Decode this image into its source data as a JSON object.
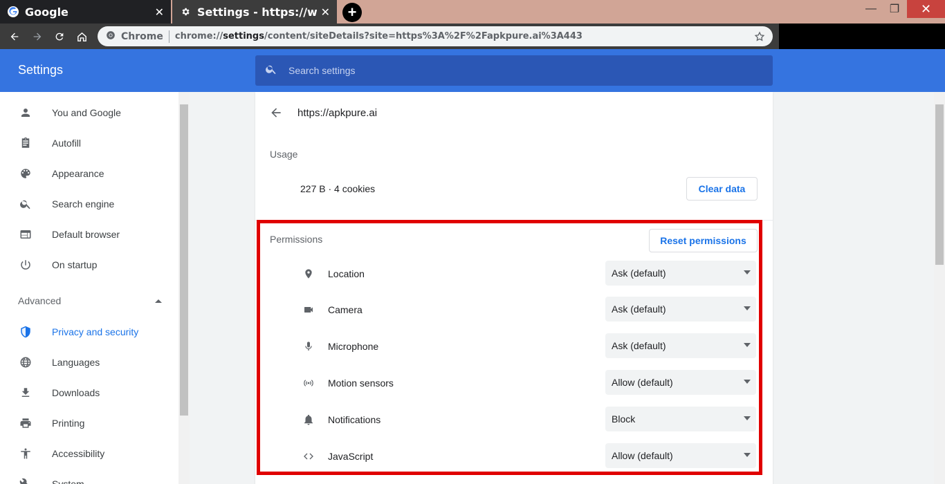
{
  "browser": {
    "tabs": [
      {
        "title": "Google",
        "icon": "google-icon",
        "active": false
      },
      {
        "title": "Settings - https://www.",
        "icon": "gear-icon",
        "active": true
      }
    ],
    "new_tab": "+",
    "omnibox": {
      "chip": "Chrome",
      "url_prefix": "chrome://",
      "url_bold": "settings",
      "url_suffix": "/content/siteDetails?site=https%3A%2F%2Fapkpure.ai%3A443"
    }
  },
  "header": {
    "title": "Settings",
    "search_placeholder": "Search settings"
  },
  "sidebar": {
    "items": [
      {
        "label": "You and Google",
        "icon": "person-icon"
      },
      {
        "label": "Autofill",
        "icon": "clipboard-icon"
      },
      {
        "label": "Appearance",
        "icon": "palette-icon"
      },
      {
        "label": "Search engine",
        "icon": "search-icon"
      },
      {
        "label": "Default browser",
        "icon": "browser-icon"
      },
      {
        "label": "On startup",
        "icon": "power-icon"
      }
    ],
    "advanced_label": "Advanced",
    "advanced_items": [
      {
        "label": "Privacy and security",
        "icon": "shield-icon",
        "active": true
      },
      {
        "label": "Languages",
        "icon": "globe-icon"
      },
      {
        "label": "Downloads",
        "icon": "download-icon"
      },
      {
        "label": "Printing",
        "icon": "printer-icon"
      },
      {
        "label": "Accessibility",
        "icon": "accessibility-icon"
      },
      {
        "label": "System",
        "icon": "wrench-icon"
      }
    ]
  },
  "site_details": {
    "site": "https://apkpure.ai",
    "usage_label": "Usage",
    "usage_value": "227 B · 4 cookies",
    "clear_button": "Clear data",
    "permissions_label": "Permissions",
    "reset_button": "Reset permissions",
    "permissions": [
      {
        "name": "Location",
        "value": "Ask (default)",
        "icon": "location-pin-icon"
      },
      {
        "name": "Camera",
        "value": "Ask (default)",
        "icon": "camera-icon"
      },
      {
        "name": "Microphone",
        "value": "Ask (default)",
        "icon": "microphone-icon"
      },
      {
        "name": "Motion sensors",
        "value": "Allow (default)",
        "icon": "sensors-icon"
      },
      {
        "name": "Notifications",
        "value": "Block",
        "icon": "bell-icon"
      },
      {
        "name": "JavaScript",
        "value": "Allow (default)",
        "icon": "code-icon"
      }
    ]
  },
  "colors": {
    "header_blue": "#3574e0",
    "search_blue": "#2b57b5",
    "accent": "#1a73e8",
    "highlight_red": "#e00000"
  }
}
